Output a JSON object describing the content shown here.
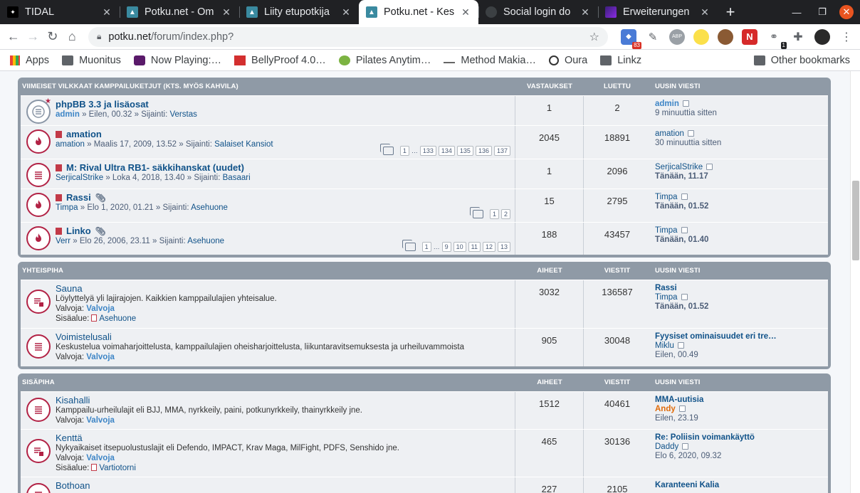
{
  "browser": {
    "tabs": [
      {
        "title": "TIDAL",
        "fav": "tidal"
      },
      {
        "title": "Potku.net - Om",
        "fav": "potku"
      },
      {
        "title": "Liity etupotkija",
        "fav": "potku"
      },
      {
        "title": "Potku.net - Kes",
        "fav": "potku",
        "active": true
      },
      {
        "title": "Social login do",
        "fav": "globe"
      },
      {
        "title": "Erweiterungen",
        "fav": "ext"
      }
    ],
    "url_host": "potku.net",
    "url_path": "/forum/index.php?",
    "ext_badge_1": "83",
    "ext_badge_2": "1",
    "ext_abp": "ABP",
    "ext_n": "N",
    "bookmarks": [
      "Apps",
      "Muonitus",
      "Now Playing:…",
      "BellyProof 4.0…",
      "Pilates Anytim…",
      "Method Makia…",
      "Oura",
      "Linkz"
    ],
    "other_bookmarks": "Other bookmarks"
  },
  "sections": [
    {
      "header": "Viimeiset vilkkaat kamppailuketjut (kts. myös kahvila)",
      "col2": "Vastaukset",
      "col3": "Luettu",
      "col4": "Uusin viesti",
      "rows": [
        {
          "title": "phpBB 3.3 ja lisäosat",
          "meta_user": "admin",
          "meta_date": "» Eilen, 00.32 » Sijainti:",
          "meta_loc": "Verstas",
          "v1": "1",
          "v2": "2",
          "last_user": "admin",
          "last_time": "9 minuuttia sitten"
        },
        {
          "title": "amation",
          "meta_user": "amation",
          "meta_date": "» Maalis 17, 2009, 13.52 » Sijainti:",
          "meta_loc": "Salaiset Kansiot",
          "v1": "2045",
          "v2": "18891",
          "last_user": "amation",
          "last_time": "30 minuuttia sitten",
          "pages": [
            "1",
            "…",
            "133",
            "134",
            "135",
            "136",
            "137"
          ]
        },
        {
          "title": "M: Rival Ultra RB1- säkkihanskat (uudet)",
          "meta_user": "SerjicalStrike",
          "meta_date": "» Loka 4, 2018, 13.40 » Sijainti:",
          "meta_loc": "Basaari",
          "v1": "1",
          "v2": "2096",
          "last_user": "SerjicalStrike",
          "last_time": "Tänään, 11.17"
        },
        {
          "title": "Rassi",
          "meta_user": "Timpa",
          "meta_date": "» Elo 1, 2020, 01.21 » Sijainti:",
          "meta_loc": "Asehuone",
          "v1": "15",
          "v2": "2795",
          "last_user": "Timpa",
          "last_time": "Tänään, 01.52",
          "pages": [
            "1",
            "2"
          ]
        },
        {
          "title": "Linko",
          "meta_user": "Verr",
          "meta_date": "» Elo 26, 2006, 23.11 » Sijainti:",
          "meta_loc": "Asehuone",
          "v1": "188",
          "v2": "43457",
          "last_user": "Timpa",
          "last_time": "Tänään, 01.40",
          "pages": [
            "1",
            "…",
            "9",
            "10",
            "11",
            "12",
            "13"
          ]
        }
      ]
    },
    {
      "header": "Yhteispiha",
      "col2": "Aiheet",
      "col3": "Viestit",
      "col4": "Uusin viesti",
      "rows": [
        {
          "title": "Sauna",
          "desc": "Löylyttelyä yli lajirajojen. Kaikkien kamppailulajien yhteisalue.",
          "mod_label": "Valvoja:",
          "mod": "Valvoja",
          "sub_label": "Sisäalue:",
          "sub": "Asehuone",
          "v1": "3032",
          "v2": "136587",
          "last_title": "Rassi",
          "last_user": "Timpa",
          "last_time": "Tänään, 01.52"
        },
        {
          "title": "Voimistelusali",
          "desc": "Keskustelua voimaharjoittelusta, kamppailulajien oheisharjoittelusta, liikuntaravitsemuksesta ja urheiluvammoista",
          "mod_label": "Valvoja:",
          "mod": "Valvoja",
          "v1": "905",
          "v2": "30048",
          "last_title": "Fyysiset ominaisuudet eri tre…",
          "last_user": "Miklu",
          "last_time": "Eilen, 00.49"
        }
      ]
    },
    {
      "header": "Sisäpiha",
      "col2": "Aiheet",
      "col3": "Viestit",
      "col4": "Uusin viesti",
      "rows": [
        {
          "title": "Kisahalli",
          "desc": "Kamppailu-urheilulajit eli BJJ, MMA, nyrkkeily, paini, potkunyrkkeily, thainyrkkeily jne.",
          "mod_label": "Valvoja:",
          "mod": "Valvoja",
          "v1": "1512",
          "v2": "40461",
          "last_title": "MMA-uutisia",
          "last_user": "Andy",
          "last_user_style": "orange",
          "last_time": "Eilen, 23.19"
        },
        {
          "title": "Kenttä",
          "desc": "Nykyaikaiset itsepuolustuslajit eli Defendo, IMPACT, Krav Maga, MilFight, PDFS, Senshido jne.",
          "mod_label": "Valvoja:",
          "mod": "Valvoja",
          "sub_label": "Sisäalue:",
          "sub": "Vartiotorni",
          "v1": "465",
          "v2": "30136",
          "last_title": "Re: Poliisin voimankäyttö",
          "last_user": "Daddy",
          "last_time": "Elo 6, 2020, 09.32"
        },
        {
          "title": "Bothoan",
          "v1": "227",
          "v2": "2105",
          "last_title": "Karanteeni Kalia"
        }
      ]
    }
  ]
}
